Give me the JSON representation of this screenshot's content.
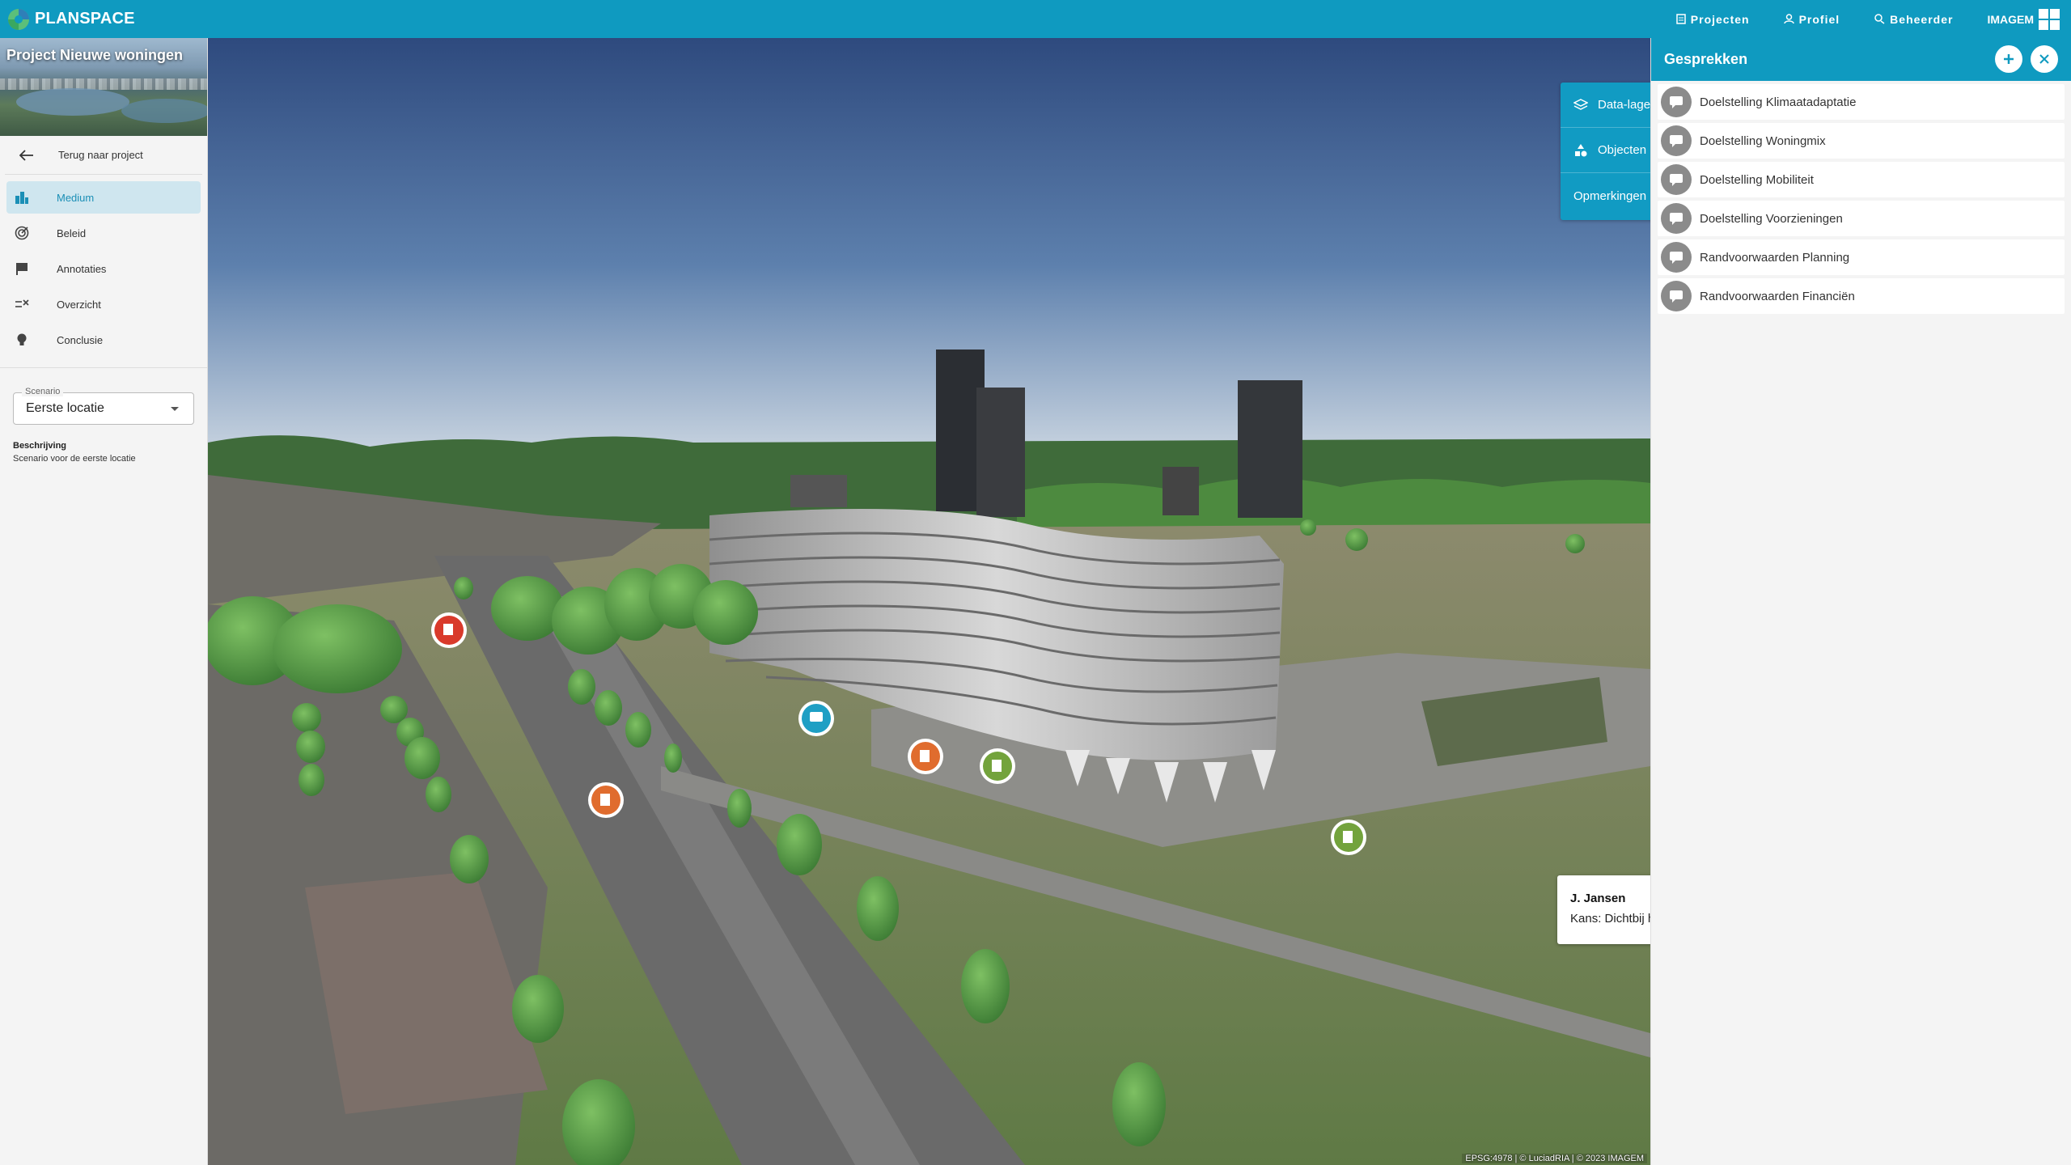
{
  "topbar": {
    "brand": "PLANSPACE",
    "nav": [
      {
        "label": "Projecten",
        "icon": "document-icon"
      },
      {
        "label": "Profiel",
        "icon": "user-icon"
      },
      {
        "label": "Beheerder",
        "icon": "admin-icon"
      }
    ],
    "company": "IMAGEM"
  },
  "sidebar": {
    "project_title": "Project Nieuwe woningen",
    "back_label": "Terug naar project",
    "items": [
      {
        "label": "Medium",
        "icon": "buildings-icon",
        "active": true
      },
      {
        "label": "Beleid",
        "icon": "target-icon",
        "active": false
      },
      {
        "label": "Annotaties",
        "icon": "flag-icon",
        "active": false
      },
      {
        "label": "Overzicht",
        "icon": "checklist-icon",
        "active": false
      },
      {
        "label": "Conclusie",
        "icon": "lightbulb-icon",
        "active": false
      }
    ],
    "scenario": {
      "legend": "Scenario",
      "value": "Eerste locatie"
    },
    "description": {
      "title": "Beschrijving",
      "text": "Scenario voor de eerste locatie"
    }
  },
  "layers_panel": {
    "rows": [
      {
        "label": "Data-lagen",
        "icon": "layers-icon"
      },
      {
        "label": "Objecten",
        "icon": "shapes-icon"
      },
      {
        "label": "Opmerkingen",
        "icon": ""
      }
    ]
  },
  "tooltip": {
    "name": "J. Jansen",
    "text": "Kans: Dichtbij het station"
  },
  "markers": [
    {
      "type": "red-marker",
      "color": "#d93a2b"
    },
    {
      "type": "comment-marker",
      "color": "#1e9fc4"
    },
    {
      "type": "orange-marker",
      "color": "#e06c2e"
    },
    {
      "type": "green-marker",
      "color": "#73a33c"
    }
  ],
  "attribution": "EPSG:4978  |  © LuciadRIA  |  © 2023 IMAGEM",
  "rightpanel": {
    "title": "Gesprekken",
    "conversations": [
      "Doelstelling Klimaatadaptatie",
      "Doelstelling Woningmix",
      "Doelstelling Mobiliteit",
      "Doelstelling Voorzieningen",
      "Randvoorwaarden Planning",
      "Randvoorwaarden Financiën"
    ]
  },
  "colors": {
    "accent": "#0f9ac0",
    "active_bg": "#cfe6ef",
    "active_text": "#1b8fb6"
  }
}
